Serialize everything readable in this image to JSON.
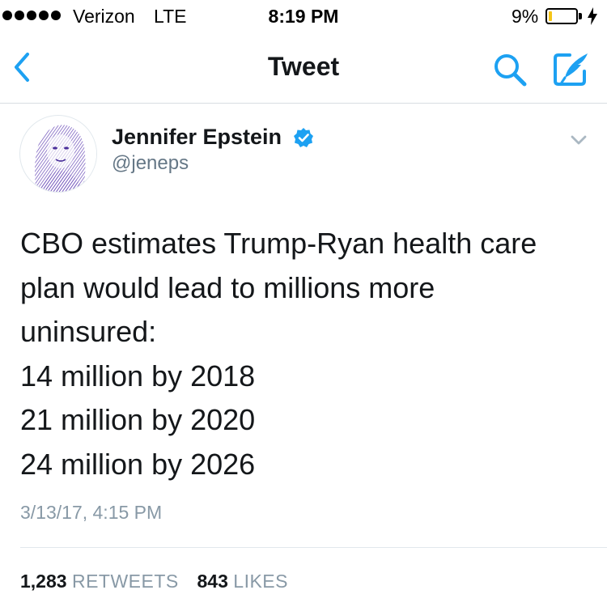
{
  "status_bar": {
    "carrier": "Verizon",
    "network": "LTE",
    "time": "8:19 PM",
    "battery_percent": "9%",
    "battery_level": 0.09,
    "signal_bars": 5
  },
  "nav": {
    "title": "Tweet",
    "back_icon": "chevron-left-icon",
    "search_icon": "search-icon",
    "compose_icon": "compose-icon"
  },
  "tweet": {
    "author_name": "Jennifer Epstein",
    "author_handle": "@jeneps",
    "verified": true,
    "text": "CBO estimates Trump-Ryan health care\nplan would lead to millions more\nuninsured:\n14 million by 2018\n21 million by 2020\n24 million by 2026",
    "timestamp": "3/13/17, 4:15 PM",
    "retweets_count": "1,283",
    "retweets_label": "RETWEETS",
    "likes_count": "843",
    "likes_label": "LIKES"
  },
  "colors": {
    "accent": "#1da1f2",
    "secondary_text": "#8899a6",
    "battery_low": "#f5c518"
  }
}
